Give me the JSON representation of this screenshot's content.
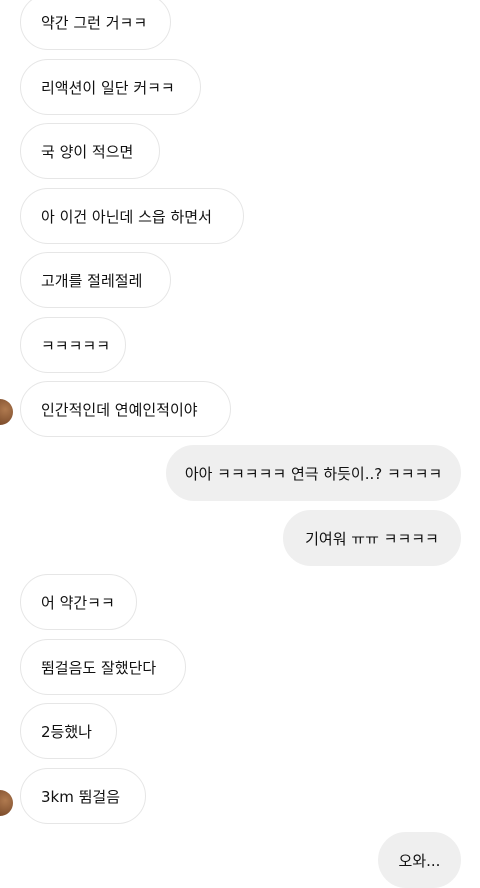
{
  "conversation": {
    "messages": [
      {
        "from": "them",
        "text": "약간 그런 거ㅋㅋ"
      },
      {
        "from": "them",
        "text": "리액션이 일단 커ㅋㅋ"
      },
      {
        "from": "them",
        "text": "국 양이 적으면"
      },
      {
        "from": "them",
        "text": "아 이건 아닌데 스읍 하면서"
      },
      {
        "from": "them",
        "text": "고개를 절레절레"
      },
      {
        "from": "them",
        "text": "ㅋㅋㅋㅋㅋ"
      },
      {
        "from": "them",
        "text": "인간적인데 연예인적이야"
      },
      {
        "from": "me",
        "text": "아아 ㅋㅋㅋㅋㅋ 연극 하듯이..? ㅋㅋㅋㅋ"
      },
      {
        "from": "me",
        "text": "기여워 ㅠㅠ ㅋㅋㅋㅋ"
      },
      {
        "from": "them",
        "text": "어 약간ㅋㅋ"
      },
      {
        "from": "them",
        "text": "뜀걸음도 잘했단다"
      },
      {
        "from": "them",
        "text": "2등했나"
      },
      {
        "from": "them",
        "text": "3km 뜀걸음"
      },
      {
        "from": "me",
        "text": "오와..."
      }
    ]
  },
  "colors": {
    "background": "#ffffff",
    "received_bubble_bg": "#ffffff",
    "received_bubble_border": "#e6e6e6",
    "sent_bubble_bg": "#efefef",
    "text": "#111111",
    "avatar": "#8a5632"
  }
}
